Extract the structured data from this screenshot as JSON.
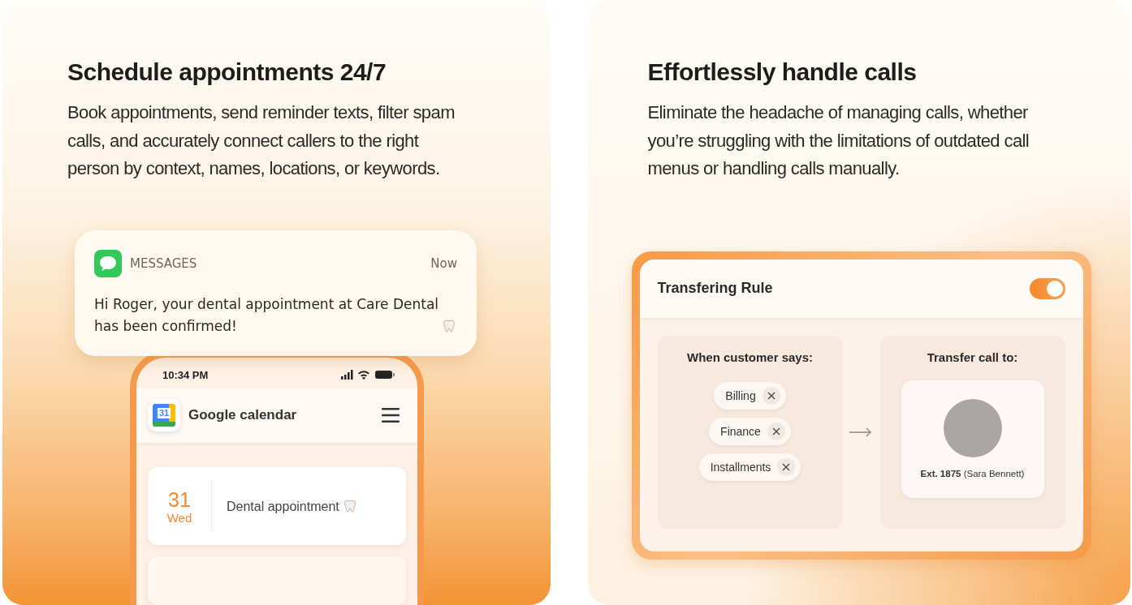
{
  "schedule_card": {
    "title": "Schedule appointments 24/7",
    "body": "Book appointments, send reminder texts, filter spam calls, and accurately connect callers to the right person by context, names, locations, or keywords.",
    "notification": {
      "app": "MESSAGES",
      "time": "Now",
      "message": "Hi Roger, your dental appointment at Care Dental has been confirmed!"
    },
    "phone": {
      "time": "10:34 PM",
      "calendar_icon_day": "31",
      "app_title": "Google calendar",
      "events": [
        {
          "day": "31",
          "weekday": "Wed",
          "title": "Dental appointment"
        }
      ]
    }
  },
  "calls_card": {
    "title": "Effortlessly handle calls",
    "body": "Eliminate the headache of managing calls, whether you’re struggling with the limitations of outdated call menus or handling calls manually.",
    "rule": {
      "title": "Transfering Rule",
      "on": true,
      "trigger_heading": "When customer says:",
      "keywords": [
        {
          "label": "Billing"
        },
        {
          "label": "Finance"
        },
        {
          "label": "Installments"
        }
      ],
      "target_heading": "Transfer call to:",
      "target": "**Ext. 1875** (Sara Bennett)"
    }
  }
}
